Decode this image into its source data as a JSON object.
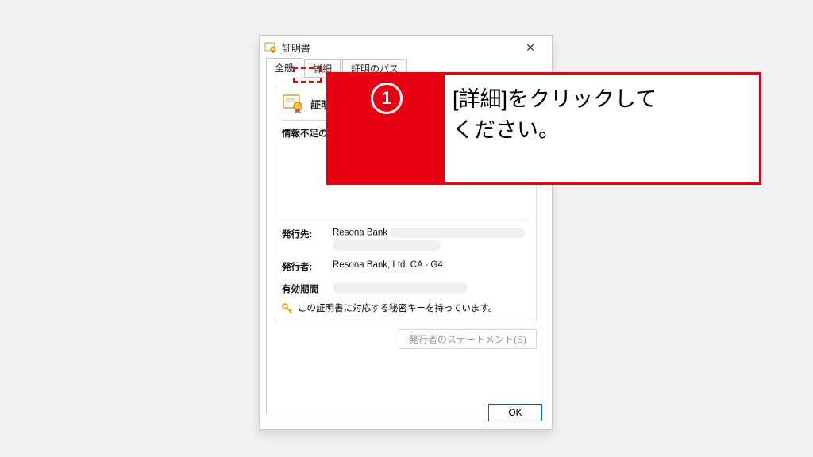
{
  "dialog": {
    "title": "証明書",
    "close_glyph": "✕"
  },
  "tabs": {
    "general": "全般",
    "details": "詳細",
    "path": "証明のパス"
  },
  "content": {
    "heading": "証明書の情報",
    "warning": "情報不足のため、この証明書を検証できません。",
    "issued_to_label": "発行先:",
    "issued_to_value": "Resona Bank",
    "issuer_label": "発行者:",
    "issuer_value": "Resona Bank, Ltd. CA - G4",
    "validity_label": "有効期間",
    "key_note": "この証明書に対応する秘密キーを持っています。",
    "statement_btn": "発行者のステートメント(S)"
  },
  "buttons": {
    "ok": "OK"
  },
  "annotation": {
    "number": "1",
    "line1": "[詳細]をクリックして",
    "line2": "ください。"
  }
}
